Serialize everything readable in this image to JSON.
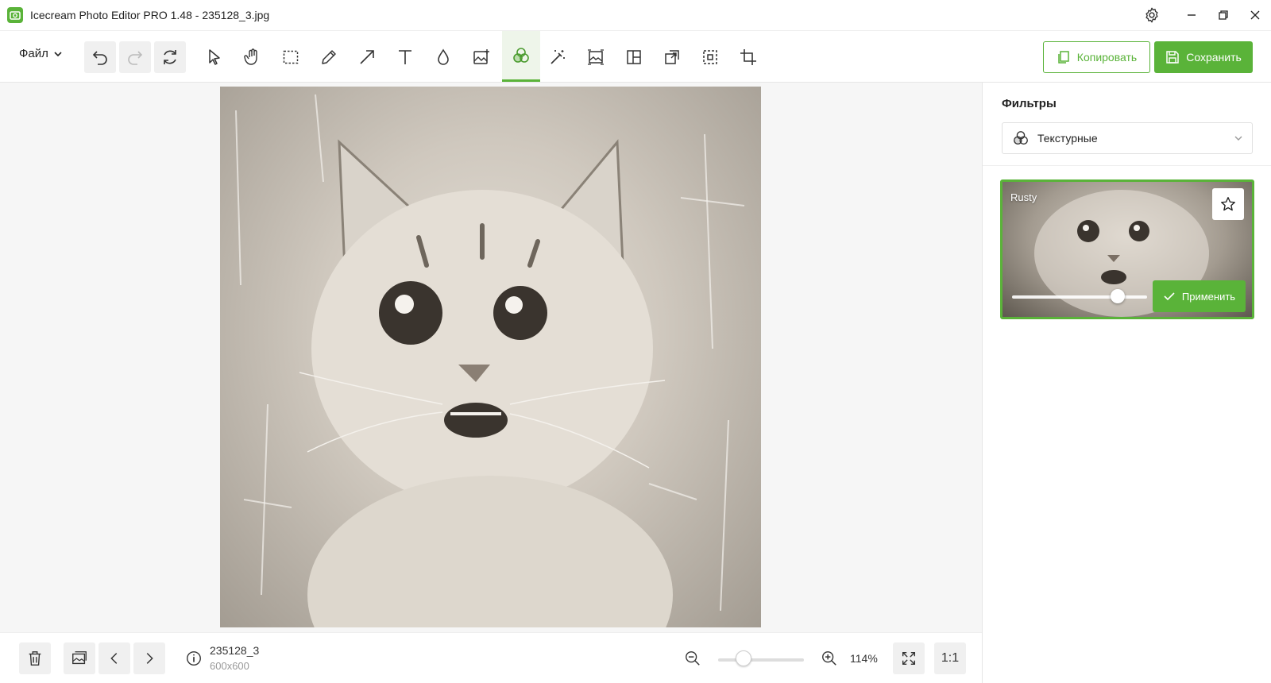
{
  "window": {
    "title": "Icecream Photo Editor PRO 1.48 - 235128_3.jpg"
  },
  "toolbar": {
    "file_menu_label": "Файл",
    "copy_label": "Копировать",
    "save_label": "Сохранить",
    "active_tool": "filters-tool",
    "accent_color": "#5ab339"
  },
  "filters_panel": {
    "title": "Фильтры",
    "category_selected": "Текстурные",
    "cards": [
      {
        "name": "Rusty",
        "apply_label": "Применить",
        "intensity_percent": 78
      }
    ]
  },
  "image_info": {
    "file_name": "235128_3",
    "dimensions": "600x600"
  },
  "zoom": {
    "percent_label": "114%",
    "one_to_one_label": "1:1",
    "slider_fraction": 0.3
  }
}
